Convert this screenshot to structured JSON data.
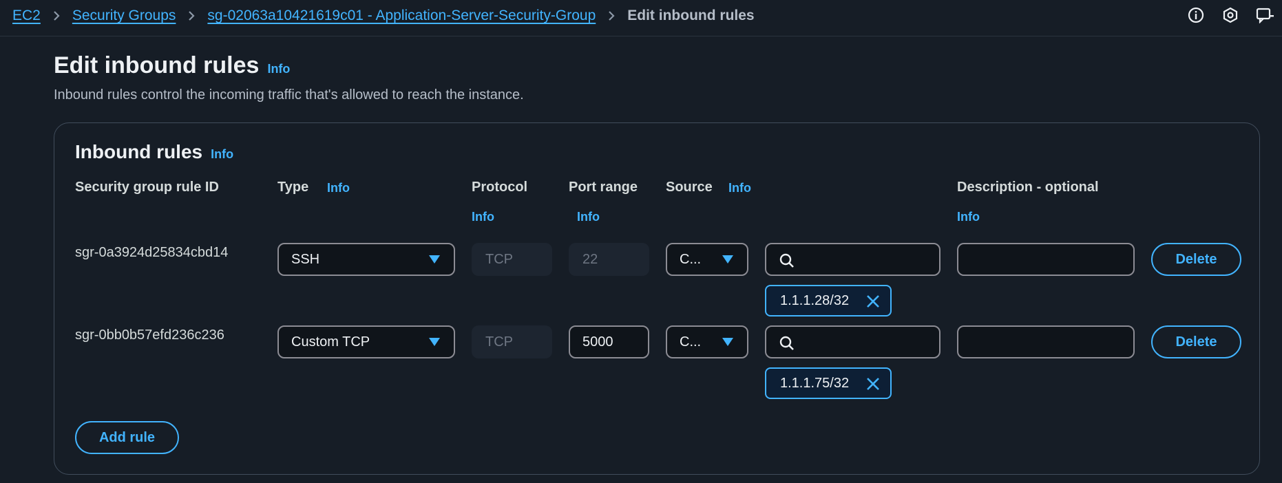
{
  "breadcrumb": {
    "items": [
      "EC2",
      "Security Groups",
      "sg-02063a10421619c01 - Application-Server-Security-Group"
    ],
    "current": "Edit inbound rules"
  },
  "header": {
    "title": "Edit inbound rules",
    "info": "Info",
    "description": "Inbound rules control the incoming traffic that's allowed to reach the instance."
  },
  "panel": {
    "title": "Inbound rules",
    "info": "Info",
    "columns": {
      "rule_id": "Security group rule ID",
      "type": "Type",
      "type_info": "Info",
      "protocol": "Protocol",
      "protocol_info": "Info",
      "port_range": "Port range",
      "port_info": "Info",
      "source": "Source",
      "source_info": "Info",
      "description": "Description - optional",
      "description_info": "Info"
    },
    "rules": [
      {
        "id": "sgr-0a3924d25834cbd14",
        "type": "SSH",
        "protocol": "TCP",
        "port": "22",
        "source": "C...",
        "search": "",
        "token": "1.1.1.28/32",
        "description": "",
        "delete": "Delete"
      },
      {
        "id": "sgr-0bb0b57efd236c236",
        "type": "Custom TCP",
        "protocol": "TCP",
        "port": "5000",
        "source": "C...",
        "search": "",
        "token": "1.1.1.75/32",
        "description": "",
        "delete": "Delete"
      }
    ],
    "add_rule": "Add rule"
  },
  "colors": {
    "background": "#161d26",
    "accent": "#42b4ff",
    "border": "#8c8c94"
  },
  "icons": [
    "info-icon",
    "settings-icon",
    "feedback-icon",
    "search-icon",
    "close-icon",
    "chevron-right-icon",
    "caret-down-icon"
  ]
}
